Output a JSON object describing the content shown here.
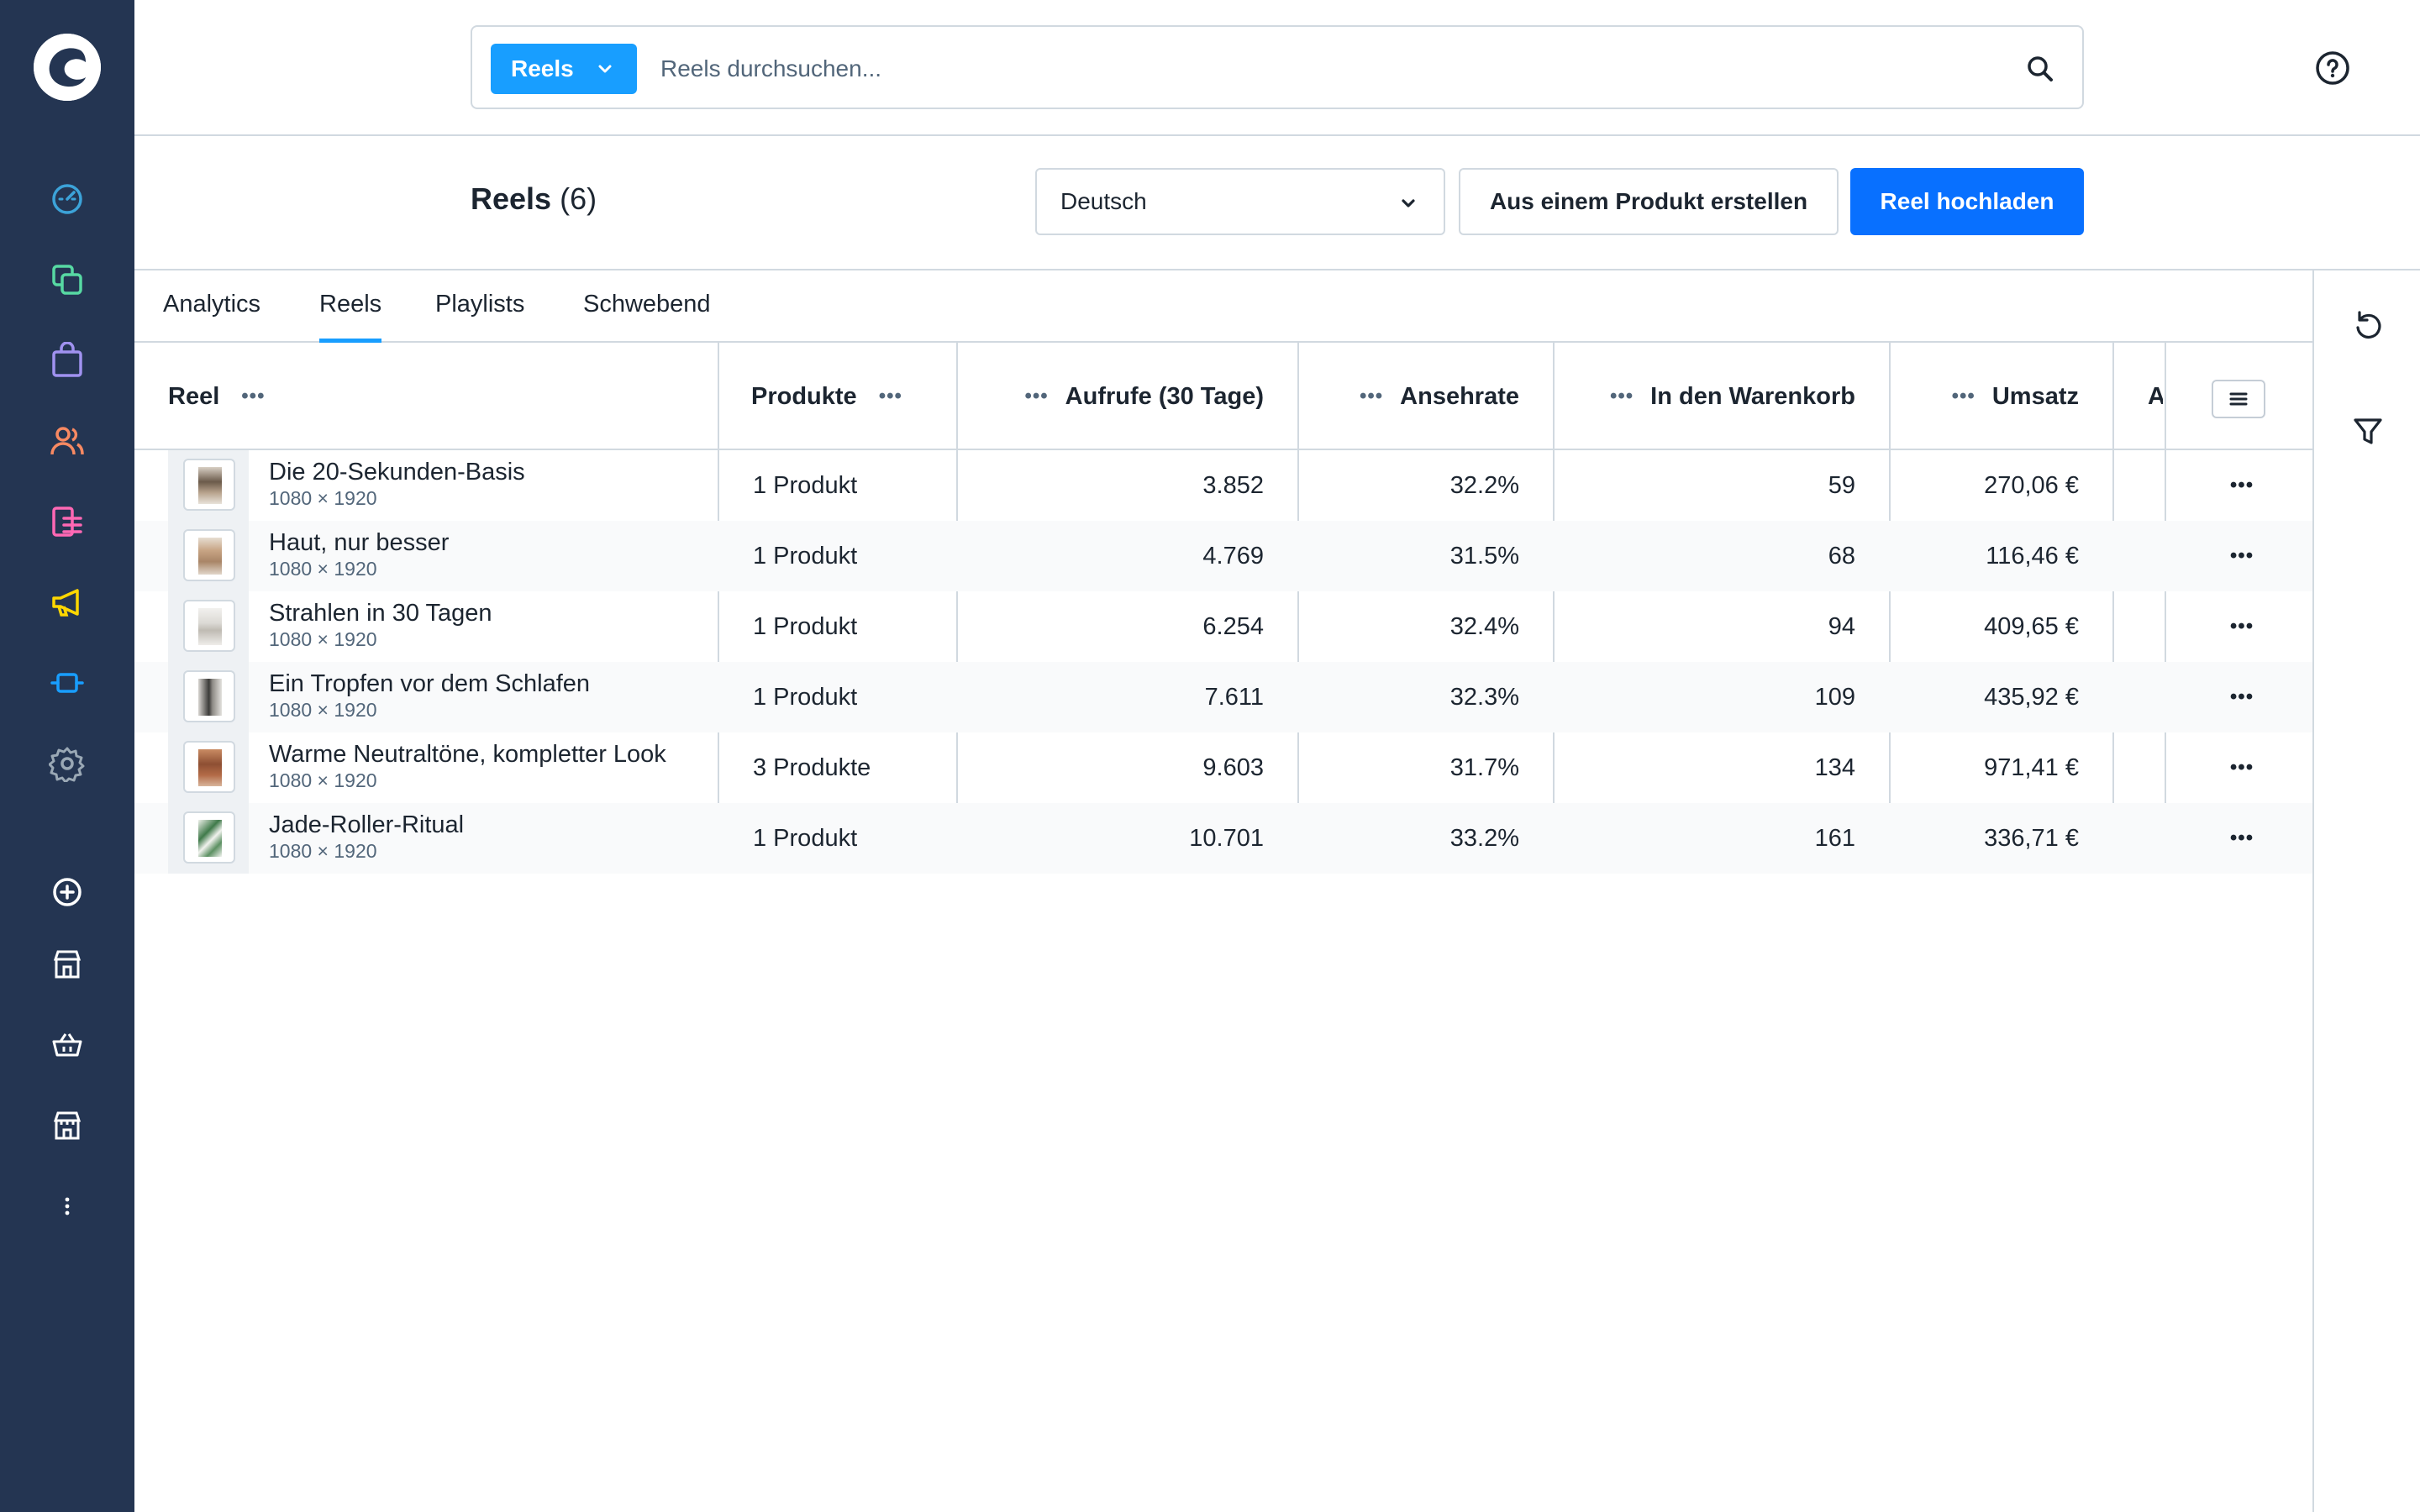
{
  "colors": {
    "sidebar_bg": "#243552",
    "primary": "#0870ff",
    "accent": "#189eff",
    "border": "#d1d9e0"
  },
  "sidebar": {
    "logo": "shopware-logo",
    "items": [
      {
        "icon": "dashboard-icon",
        "color": "#3ca3d9"
      },
      {
        "icon": "products-icon",
        "color": "#57d9a3"
      },
      {
        "icon": "orders-icon",
        "color": "#a092f0"
      },
      {
        "icon": "customers-icon",
        "color": "#f88962"
      },
      {
        "icon": "content-icon",
        "color": "#ff68b4"
      },
      {
        "icon": "marketing-icon",
        "color": "#ffd700"
      },
      {
        "icon": "extensions-icon",
        "color": "#189eff"
      },
      {
        "icon": "settings-icon",
        "color": "#9aa8b5"
      }
    ],
    "bottom_items": [
      {
        "icon": "add-icon"
      },
      {
        "icon": "storefront-icon"
      },
      {
        "icon": "basket-icon"
      },
      {
        "icon": "store-icon"
      },
      {
        "icon": "more-vertical-icon"
      }
    ]
  },
  "header": {
    "search_type": "Reels",
    "search_placeholder": "Reels durchsuchen...",
    "help_icon": "help-icon"
  },
  "smartbar": {
    "title": "Reels",
    "count": "(6)",
    "language": "Deutsch",
    "create_from_product": "Aus einem Produkt erstellen",
    "upload": "Reel hochladen"
  },
  "tabs": [
    {
      "label": "Analytics",
      "active": false
    },
    {
      "label": "Reels",
      "active": true
    },
    {
      "label": "Playlists",
      "active": false
    },
    {
      "label": "Schwebend",
      "active": false
    }
  ],
  "table": {
    "columns": {
      "reel": "Reel",
      "products": "Produkte",
      "views": "Aufrufe (30 Tage)",
      "watch_rate": "Ansehrate",
      "add_to_cart": "In den Warenkorb",
      "revenue": "Umsatz",
      "truncated": "A"
    },
    "rows": [
      {
        "name": "Die 20-Sekunden-Basis",
        "dimensions": "1080 × 1920",
        "products": "1 Produkt",
        "views": "3.852",
        "watch_rate": "32.2%",
        "add_to_cart": "59",
        "revenue": "270,06 €"
      },
      {
        "name": "Haut, nur besser",
        "dimensions": "1080 × 1920",
        "products": "1 Produkt",
        "views": "4.769",
        "watch_rate": "31.5%",
        "add_to_cart": "68",
        "revenue": "116,46 €"
      },
      {
        "name": "Strahlen in 30 Tagen",
        "dimensions": "1080 × 1920",
        "products": "1 Produkt",
        "views": "6.254",
        "watch_rate": "32.4%",
        "add_to_cart": "94",
        "revenue": "409,65 €"
      },
      {
        "name": "Ein Tropfen vor dem Schlafen",
        "dimensions": "1080 × 1920",
        "products": "1 Produkt",
        "views": "7.611",
        "watch_rate": "32.3%",
        "add_to_cart": "109",
        "revenue": "435,92 €"
      },
      {
        "name": "Warme Neutraltöne, kompletter Look",
        "dimensions": "1080 × 1920",
        "products": "3 Produkte",
        "views": "9.603",
        "watch_rate": "31.7%",
        "add_to_cart": "134",
        "revenue": "971,41 €"
      },
      {
        "name": "Jade-Roller-Ritual",
        "dimensions": "1080 × 1920",
        "products": "1 Produkt",
        "views": "10.701",
        "watch_rate": "33.2%",
        "add_to_cart": "161",
        "revenue": "336,71 €"
      }
    ]
  },
  "right_sidebar": {
    "items": [
      {
        "icon": "refresh-icon"
      },
      {
        "icon": "filter-icon"
      }
    ]
  }
}
